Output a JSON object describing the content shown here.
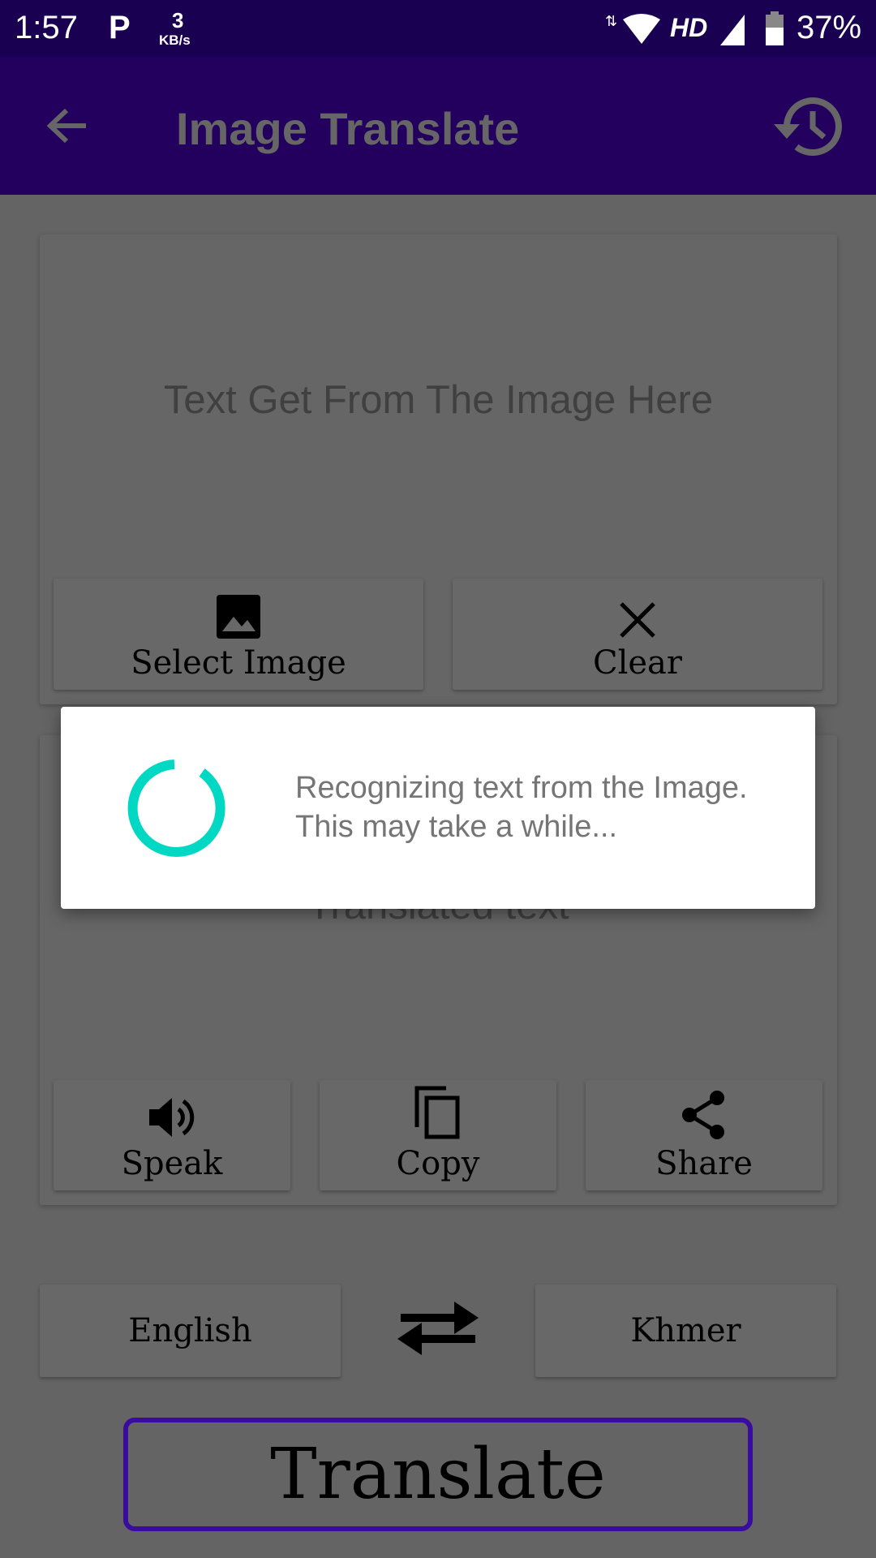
{
  "status_bar": {
    "time": "1:57",
    "app_icon": "p-icon",
    "net_speed_value": "3",
    "net_speed_unit": "KB/s",
    "hd": "HD",
    "battery": "37%"
  },
  "toolbar": {
    "title": "Image Translate",
    "back_icon": "arrow-left-icon",
    "history_icon": "history-icon"
  },
  "source_card": {
    "placeholder": "Text Get From The Image Here",
    "select_image": "Select Image",
    "clear": "Clear"
  },
  "result_card": {
    "placeholder": "Translated text",
    "speak": "Speak",
    "copy": "Copy",
    "share": "Share"
  },
  "languages": {
    "from": "English",
    "to": "Khmer",
    "swap_icon": "swap-horizontal-icon"
  },
  "translate_button": "Translate",
  "dialog": {
    "message": "Recognizing text from the Image. This may take a while..."
  },
  "colors": {
    "status_bar": "#1a0050",
    "toolbar": "#24005e",
    "spinner": "#00d8c4",
    "translate_border": "#3a0c9e"
  }
}
